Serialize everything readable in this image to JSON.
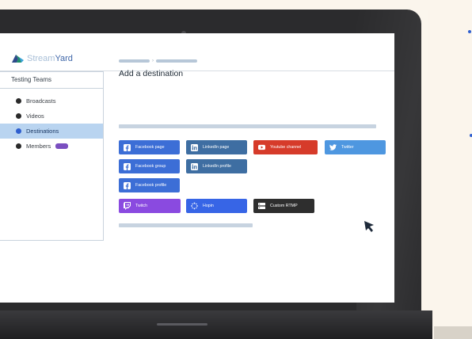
{
  "brand": {
    "name_part1": "Stream",
    "name_part2": "Yard"
  },
  "sidebar": {
    "team_name": "Testing Teams",
    "items": [
      {
        "label": "Broadcasts",
        "active": false
      },
      {
        "label": "Videos",
        "active": false
      },
      {
        "label": "Destinations",
        "active": true
      },
      {
        "label": "Members",
        "active": false,
        "badge_color": "#7a4fc0"
      }
    ]
  },
  "main": {
    "title": "Add a destination",
    "breadcrumb_separator": "›",
    "destinations": [
      {
        "label": "Facebook page",
        "color": "#3c6ed6",
        "icon": "facebook-icon"
      },
      {
        "label": "LinkedIn page",
        "color": "#3e6ea2",
        "icon": "linkedin-icon"
      },
      {
        "label": "Youtube channel",
        "color": "#d63b2a",
        "icon": "youtube-icon"
      },
      {
        "label": "Twitter",
        "color": "#4e97e0",
        "icon": "twitter-icon"
      },
      {
        "label": "Facebook group",
        "color": "#3c6ed6",
        "icon": "facebook-icon"
      },
      {
        "label": "LinkedIn profile",
        "color": "#3e6ea2",
        "icon": "linkedin-icon"
      },
      {
        "label": "Facebook profile",
        "color": "#3c6ed6",
        "icon": "facebook-icon"
      },
      {
        "label": "Twitch",
        "color": "#8a4ae0",
        "icon": "twitch-icon"
      },
      {
        "label": "Hopin",
        "color": "#3765e6",
        "icon": "hopin-icon"
      },
      {
        "label": "Custom RTMP",
        "color": "#2e2e2e",
        "icon": "rtmp-icon"
      }
    ]
  },
  "colors": {
    "accent": "#2f5fcf",
    "background": "#fbf5ec",
    "laptop": "#2b2b2d"
  }
}
